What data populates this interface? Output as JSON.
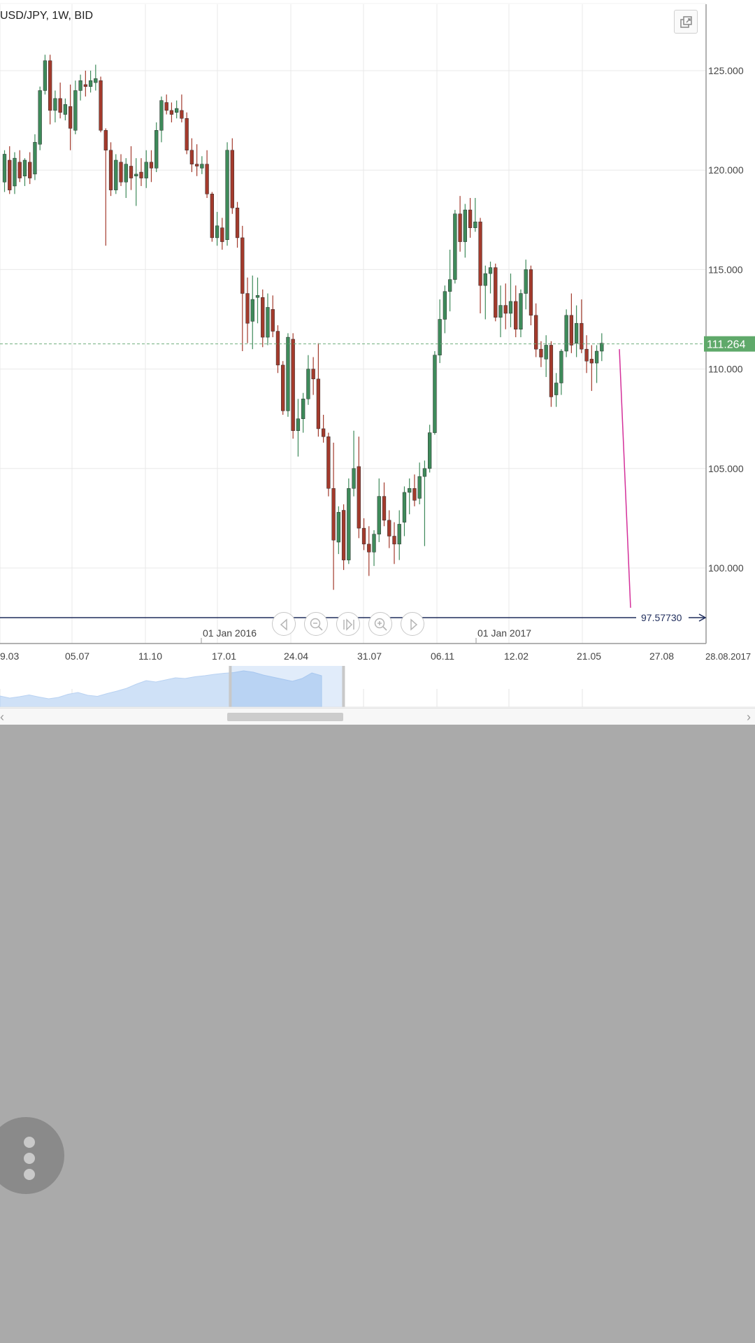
{
  "chart": {
    "title": "USD/JPY, 1W, BID",
    "last_price": "111.264",
    "line_label": "97.57730",
    "y_ticks": [
      "125.000",
      "120.000",
      "115.000",
      "110.000",
      "105.000",
      "100.000"
    ],
    "x_ticks": [
      "9.03",
      "05.07",
      "11.10",
      "17.01",
      "24.04",
      "31.07",
      "06.11",
      "12.02",
      "21.05",
      "27.08",
      "28.08.2017"
    ],
    "year_labels": [
      "01 Jan 2016",
      "01 Jan 2017"
    ],
    "colors": {
      "up": "#3e8a5a",
      "down": "#a33a2c",
      "grid": "#e8e8e8",
      "price_badge": "#5fa96a",
      "trendline": "#d4309a",
      "level_line": "#1f2d5c",
      "navigator_fill": "#cfe1f7"
    }
  },
  "chart_data": {
    "type": "candlestick",
    "title": "USD/JPY, 1W, BID",
    "ylim": [
      97.0,
      128.5
    ],
    "current_price": 111.264,
    "horizontal_line": 97.5773,
    "trendline": [
      [
        111.0,
        98.0
      ]
    ],
    "ohlc": [
      [
        119.4,
        121.0,
        118.9,
        120.8
      ],
      [
        120.5,
        121.2,
        118.8,
        119.0
      ],
      [
        119.2,
        120.9,
        118.8,
        120.6
      ],
      [
        120.4,
        121.0,
        119.4,
        119.6
      ],
      [
        119.7,
        120.6,
        119.2,
        120.5
      ],
      [
        120.4,
        120.9,
        119.3,
        119.6
      ],
      [
        119.8,
        121.8,
        119.5,
        121.4
      ],
      [
        121.3,
        124.2,
        121.0,
        124.0
      ],
      [
        124.0,
        125.8,
        123.8,
        125.5
      ],
      [
        125.5,
        125.8,
        122.3,
        123.0
      ],
      [
        123.0,
        124.0,
        122.4,
        123.6
      ],
      [
        123.6,
        124.4,
        122.6,
        122.9
      ],
      [
        122.8,
        123.6,
        122.5,
        123.3
      ],
      [
        123.2,
        124.3,
        121.0,
        122.1
      ],
      [
        122.0,
        124.5,
        121.8,
        124.0
      ],
      [
        124.0,
        124.8,
        123.5,
        124.5
      ],
      [
        124.3,
        125.0,
        123.7,
        124.2
      ],
      [
        124.2,
        125.0,
        123.9,
        124.5
      ],
      [
        124.4,
        125.3,
        124.0,
        124.6
      ],
      [
        124.5,
        124.7,
        121.9,
        122.0
      ],
      [
        122.0,
        122.1,
        116.2,
        121.0
      ],
      [
        121.0,
        121.4,
        118.7,
        119.0
      ],
      [
        119.0,
        120.8,
        118.8,
        120.5
      ],
      [
        120.4,
        120.8,
        119.2,
        119.4
      ],
      [
        119.4,
        120.6,
        118.6,
        120.3
      ],
      [
        120.2,
        121.2,
        119.0,
        119.6
      ],
      [
        119.7,
        120.6,
        118.2,
        119.8
      ],
      [
        119.9,
        120.6,
        119.2,
        119.6
      ],
      [
        119.6,
        121.0,
        119.1,
        120.4
      ],
      [
        120.4,
        121.0,
        119.4,
        120.1
      ],
      [
        120.1,
        122.4,
        119.9,
        122.0
      ],
      [
        122.0,
        123.7,
        121.4,
        123.5
      ],
      [
        123.4,
        123.8,
        122.8,
        123.0
      ],
      [
        123.0,
        123.4,
        122.4,
        122.8
      ],
      [
        122.9,
        123.5,
        122.6,
        123.1
      ],
      [
        123.0,
        123.8,
        122.4,
        122.6
      ],
      [
        122.6,
        122.9,
        120.8,
        121.0
      ],
      [
        121.0,
        121.6,
        119.9,
        120.3
      ],
      [
        120.3,
        121.3,
        119.7,
        120.2
      ],
      [
        120.1,
        120.7,
        119.8,
        120.3
      ],
      [
        120.3,
        121.0,
        118.6,
        118.8
      ],
      [
        118.8,
        118.9,
        116.4,
        116.6
      ],
      [
        116.6,
        117.9,
        116.2,
        117.2
      ],
      [
        117.1,
        117.6,
        116.0,
        116.4
      ],
      [
        116.5,
        121.4,
        116.2,
        121.0
      ],
      [
        121.0,
        121.6,
        117.8,
        118.1
      ],
      [
        118.1,
        118.4,
        116.1,
        116.6
      ],
      [
        116.6,
        117.2,
        110.9,
        113.8
      ],
      [
        113.8,
        114.6,
        111.3,
        112.3
      ],
      [
        112.4,
        114.7,
        111.0,
        113.5
      ],
      [
        113.6,
        114.6,
        112.3,
        113.7
      ],
      [
        113.6,
        114.0,
        111.1,
        111.6
      ],
      [
        111.6,
        113.8,
        111.2,
        113.1
      ],
      [
        113.0,
        113.7,
        111.6,
        111.9
      ],
      [
        111.9,
        112.2,
        109.8,
        110.2
      ],
      [
        110.2,
        110.4,
        107.7,
        107.9
      ],
      [
        107.9,
        111.8,
        107.6,
        111.6
      ],
      [
        111.5,
        111.8,
        106.5,
        106.9
      ],
      [
        106.9,
        108.5,
        105.6,
        107.5
      ],
      [
        107.5,
        108.8,
        106.8,
        108.5
      ],
      [
        108.5,
        110.7,
        108.2,
        110.0
      ],
      [
        110.0,
        110.6,
        108.7,
        109.5
      ],
      [
        109.5,
        111.3,
        106.6,
        107.0
      ],
      [
        107.0,
        107.7,
        106.3,
        106.6
      ],
      [
        106.6,
        106.8,
        103.6,
        104.0
      ],
      [
        104.0,
        106.3,
        98.9,
        101.4
      ],
      [
        101.3,
        103.1,
        100.7,
        102.8
      ],
      [
        102.9,
        103.2,
        99.9,
        100.4
      ],
      [
        100.4,
        104.5,
        100.2,
        104.0
      ],
      [
        104.0,
        106.9,
        103.6,
        105.0
      ],
      [
        105.1,
        106.6,
        101.5,
        102.0
      ],
      [
        102.0,
        102.5,
        100.9,
        101.2
      ],
      [
        101.2,
        102.1,
        99.6,
        100.8
      ],
      [
        100.8,
        101.9,
        100.1,
        101.7
      ],
      [
        101.7,
        104.5,
        101.3,
        103.6
      ],
      [
        103.6,
        104.3,
        102.1,
        102.4
      ],
      [
        102.4,
        102.9,
        101.0,
        101.6
      ],
      [
        101.6,
        102.3,
        100.2,
        101.2
      ],
      [
        101.2,
        102.9,
        100.4,
        102.2
      ],
      [
        102.3,
        104.1,
        101.6,
        103.8
      ],
      [
        103.8,
        104.5,
        102.7,
        104.0
      ],
      [
        104.0,
        104.7,
        103.1,
        103.4
      ],
      [
        103.5,
        105.3,
        103.2,
        104.6
      ],
      [
        104.6,
        105.4,
        101.1,
        105.0
      ],
      [
        105.0,
        107.2,
        104.8,
        106.8
      ],
      [
        106.8,
        110.9,
        106.7,
        110.7
      ],
      [
        110.7,
        113.5,
        110.3,
        112.5
      ],
      [
        112.5,
        114.2,
        111.8,
        113.9
      ],
      [
        113.9,
        116.0,
        112.9,
        114.5
      ],
      [
        114.5,
        118.0,
        114.3,
        117.8
      ],
      [
        117.8,
        118.7,
        115.9,
        116.4
      ],
      [
        116.4,
        118.3,
        115.6,
        118.0
      ],
      [
        118.0,
        118.6,
        116.6,
        117.1
      ],
      [
        117.1,
        118.6,
        116.9,
        117.4
      ],
      [
        117.4,
        117.6,
        112.8,
        114.2
      ],
      [
        114.2,
        115.2,
        112.5,
        114.8
      ],
      [
        114.8,
        115.4,
        113.8,
        115.1
      ],
      [
        115.1,
        115.3,
        112.4,
        112.6
      ],
      [
        112.6,
        114.2,
        111.6,
        113.2
      ],
      [
        113.2,
        114.3,
        112.0,
        112.8
      ],
      [
        112.8,
        114.8,
        112.1,
        113.4
      ],
      [
        113.4,
        114.2,
        111.6,
        112.0
      ],
      [
        112.0,
        114.0,
        111.6,
        113.8
      ],
      [
        113.8,
        115.5,
        113.0,
        115.0
      ],
      [
        115.0,
        115.2,
        112.2,
        112.7
      ],
      [
        112.7,
        113.3,
        110.6,
        111.0
      ],
      [
        111.0,
        111.4,
        110.1,
        110.6
      ],
      [
        110.5,
        111.7,
        109.6,
        111.2
      ],
      [
        111.2,
        111.4,
        108.1,
        108.6
      ],
      [
        108.7,
        109.8,
        108.1,
        109.3
      ],
      [
        109.3,
        111.0,
        108.7,
        110.9
      ],
      [
        110.9,
        113.0,
        110.6,
        112.7
      ],
      [
        112.7,
        113.8,
        110.8,
        111.2
      ],
      [
        111.3,
        113.2,
        110.6,
        112.3
      ],
      [
        112.3,
        113.5,
        110.8,
        111.0
      ],
      [
        111.0,
        111.7,
        109.8,
        110.4
      ],
      [
        110.5,
        111.2,
        108.9,
        110.3
      ],
      [
        110.3,
        111.2,
        109.3,
        110.9
      ],
      [
        110.9,
        111.8,
        110.4,
        111.3
      ]
    ]
  },
  "navigator": {
    "values": [
      0.28,
      0.22,
      0.26,
      0.31,
      0.25,
      0.2,
      0.24,
      0.33,
      0.38,
      0.3,
      0.27,
      0.35,
      0.42,
      0.5,
      0.62,
      0.72,
      0.68,
      0.74,
      0.8,
      0.78,
      0.83,
      0.86,
      0.9,
      0.93,
      0.95,
      1.0,
      0.96,
      0.88,
      0.82,
      0.76,
      0.7,
      0.78,
      0.94,
      0.86
    ],
    "selection_start_fraction": 0.305,
    "selection_end_fraction": 0.455
  },
  "fab": {
    "icon": "more-vertical-icon"
  }
}
